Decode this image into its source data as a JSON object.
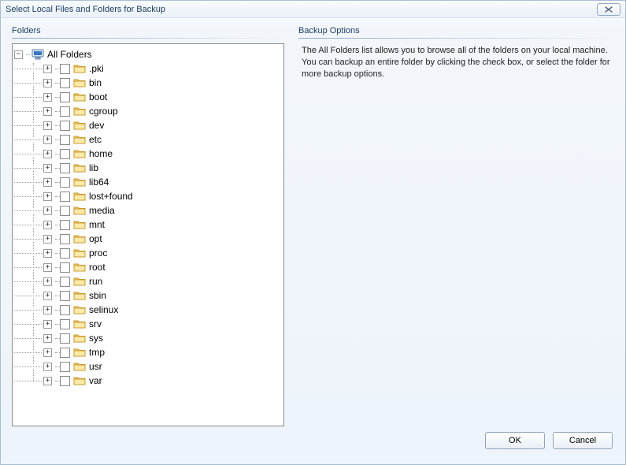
{
  "window": {
    "title": "Select Local Files and Folders for Backup"
  },
  "left_panel": {
    "header": "Folders",
    "root": {
      "label": "All Folders",
      "expanded": true
    },
    "folders": [
      ".pki",
      "bin",
      "boot",
      "cgroup",
      "dev",
      "etc",
      "home",
      "lib",
      "lib64",
      "lost+found",
      "media",
      "mnt",
      "opt",
      "proc",
      "root",
      "run",
      "sbin",
      "selinux",
      "srv",
      "sys",
      "tmp",
      "usr",
      "var"
    ]
  },
  "right_panel": {
    "header": "Backup Options",
    "description": "The All Folders list allows you to browse all of the folders on your local machine. You can backup an entire folder by clicking the check box, or select the folder for more backup options."
  },
  "buttons": {
    "ok": "OK",
    "cancel": "Cancel"
  }
}
